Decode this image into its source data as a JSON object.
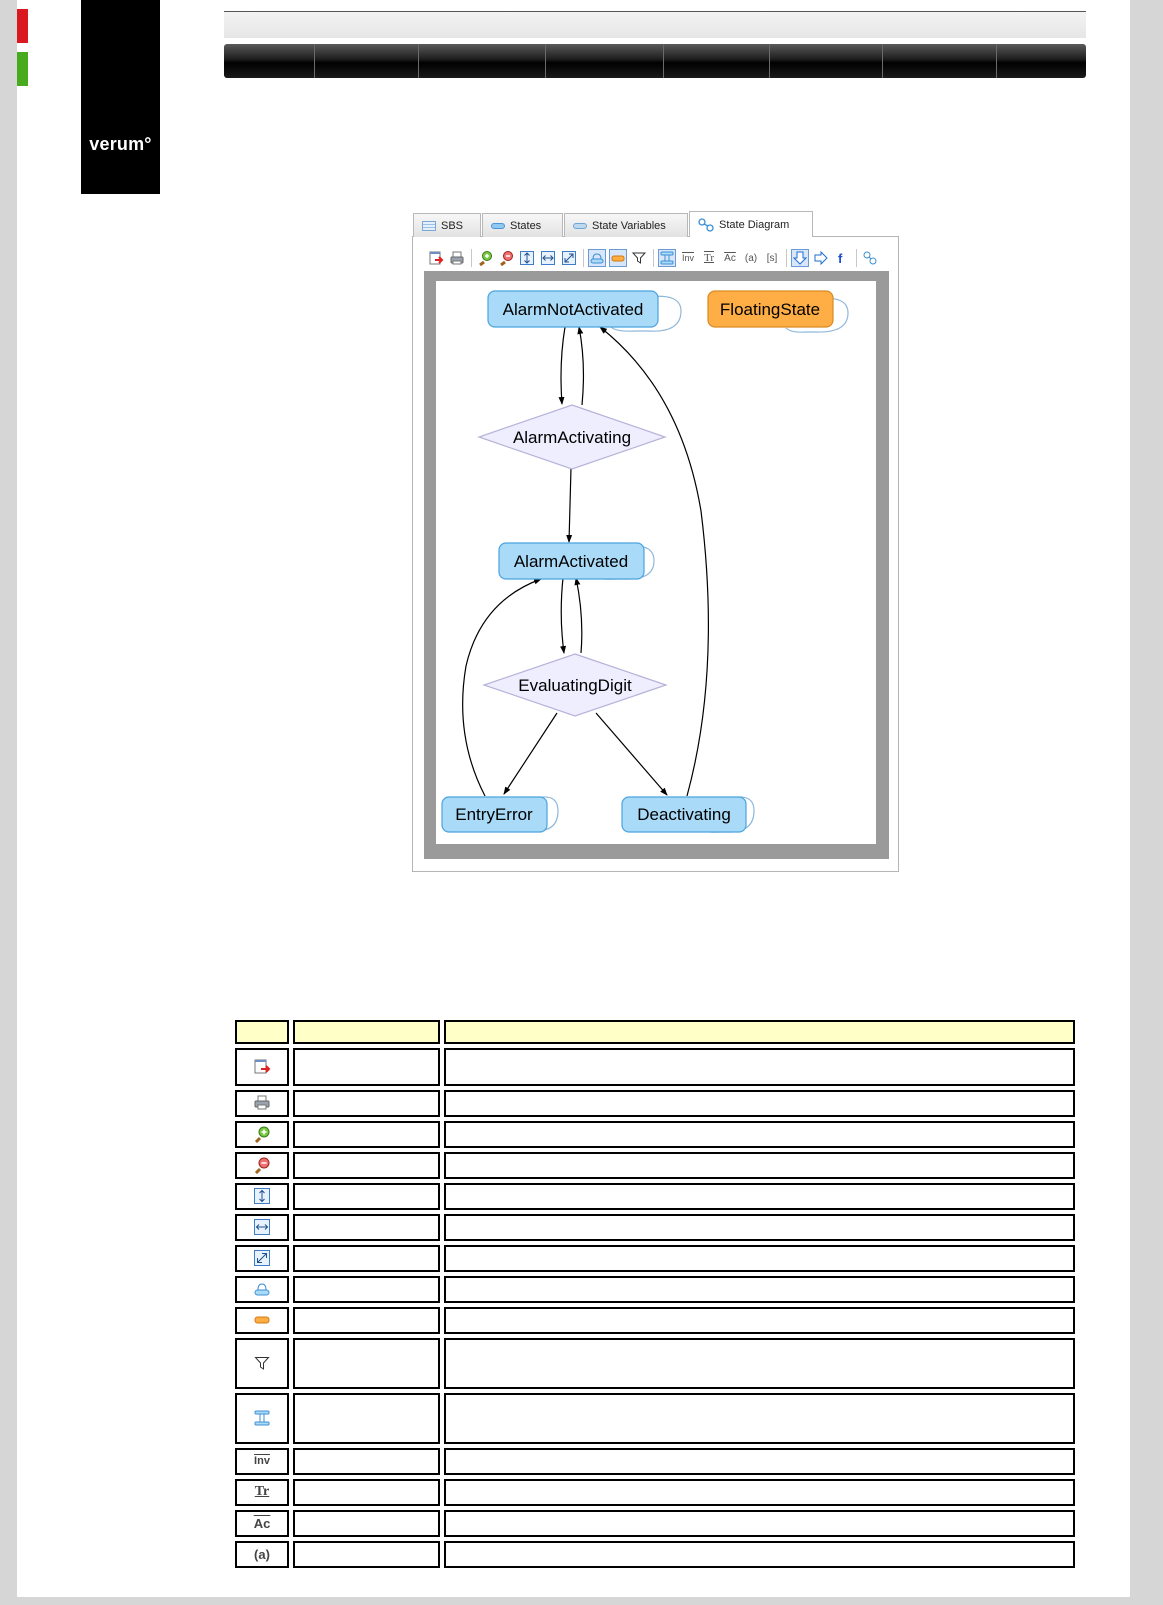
{
  "logo": {
    "text": "verum°"
  },
  "nav": {
    "item_count": 8
  },
  "window": {
    "tabs": [
      {
        "label": "SBS",
        "icon": "table-icon",
        "active": false
      },
      {
        "label": "States",
        "icon": "state-icon",
        "active": false
      },
      {
        "label": "State Variables",
        "icon": "state-variable-icon",
        "active": false
      },
      {
        "label": "State Diagram",
        "icon": "state-diagram-icon",
        "active": true
      }
    ],
    "toolbar": {
      "text_buttons": {
        "inv": "Inv",
        "tr": "Tr",
        "ac": "Ac",
        "a": "(a)",
        "s": "[s]"
      }
    }
  },
  "diagram": {
    "nodes": [
      {
        "id": "n1",
        "label": "AlarmNotActivated",
        "shape": "rounded",
        "color": "#a9dbf8"
      },
      {
        "id": "n2",
        "label": "FloatingState",
        "shape": "rounded",
        "color": "#ffae45"
      },
      {
        "id": "n3",
        "label": "AlarmActivating",
        "shape": "diamond",
        "color": "#eeeeff"
      },
      {
        "id": "n4",
        "label": "AlarmActivated",
        "shape": "rounded",
        "color": "#a9dbf8"
      },
      {
        "id": "n5",
        "label": "EvaluatingDigit",
        "shape": "diamond",
        "color": "#eeeeff"
      },
      {
        "id": "n6",
        "label": "EntryError",
        "shape": "rounded",
        "color": "#a9dbf8"
      },
      {
        "id": "n7",
        "label": "Deactivating",
        "shape": "rounded",
        "color": "#a9dbf8"
      }
    ]
  },
  "legend_table": {
    "header_color": "#ffffc8",
    "rows": [
      {
        "icon": "export-icon",
        "text": ""
      },
      {
        "icon": "print-icon",
        "text": ""
      },
      {
        "icon": "zoom-in-icon",
        "text": ""
      },
      {
        "icon": "zoom-out-icon",
        "text": ""
      },
      {
        "icon": "fit-height-icon",
        "text": ""
      },
      {
        "icon": "fit-width-icon",
        "text": ""
      },
      {
        "icon": "fit-window-icon",
        "text": ""
      },
      {
        "icon": "state-shape-icon",
        "text": ""
      },
      {
        "icon": "floating-state-icon",
        "text": ""
      },
      {
        "icon": "filter-icon",
        "text": ""
      },
      {
        "icon": "state-variable-icon",
        "text": ""
      },
      {
        "icon": "invariant-icon",
        "text": "Inv"
      },
      {
        "icon": "transition-icon",
        "text": "Tr"
      },
      {
        "icon": "action-icon",
        "text": "Ac"
      },
      {
        "icon": "a-label-icon",
        "text": "(a)"
      }
    ]
  }
}
